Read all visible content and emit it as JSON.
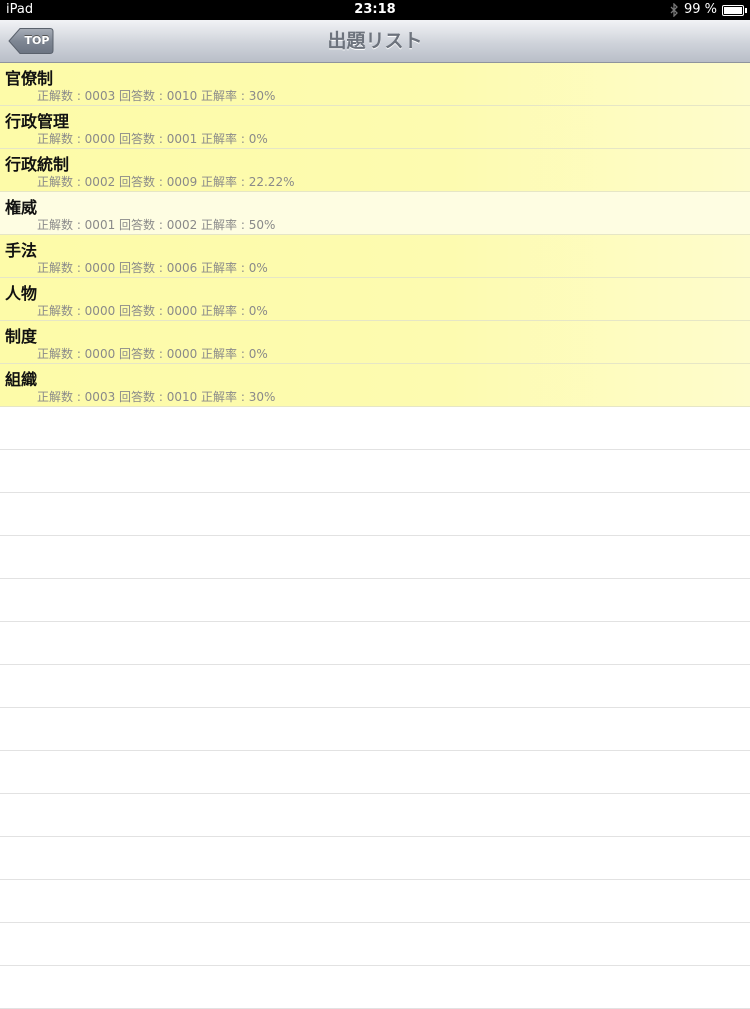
{
  "status_bar": {
    "device": "iPad",
    "time": "23:18",
    "battery": "99 %",
    "battery_level": 0.99
  },
  "nav": {
    "title": "出題リスト",
    "back_label": "TOP"
  },
  "items": [
    {
      "title": "官僚制",
      "detail": "正解数 : 0003 回答数 : 0010 正解率 : 30%",
      "style": "yellow"
    },
    {
      "title": "行政管理",
      "detail": "正解数 : 0000 回答数 : 0001 正解率 : 0%",
      "style": "yellow"
    },
    {
      "title": "行政統制",
      "detail": "正解数 : 0002 回答数 : 0009 正解率 : 22.22%",
      "style": "yellow"
    },
    {
      "title": "権威",
      "detail": "正解数 : 0001 回答数 : 0002 正解率 : 50%",
      "style": "pale"
    },
    {
      "title": "手法",
      "detail": "正解数 : 0000 回答数 : 0006 正解率 : 0%",
      "style": "yellow"
    },
    {
      "title": "人物",
      "detail": "正解数 : 0000 回答数 : 0000 正解率 : 0%",
      "style": "yellow"
    },
    {
      "title": "制度",
      "detail": "正解数 : 0000 回答数 : 0000 正解率 : 0%",
      "style": "yellow"
    },
    {
      "title": "組織",
      "detail": "正解数 : 0003 回答数 : 0010 正解率 : 30%",
      "style": "yellow"
    }
  ],
  "empty_rows": 14
}
